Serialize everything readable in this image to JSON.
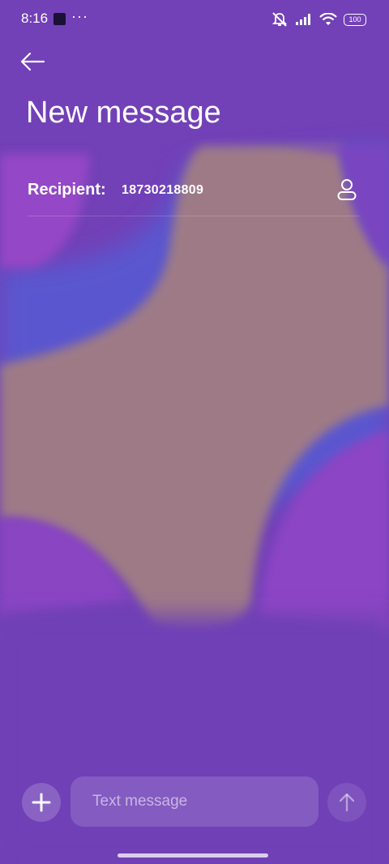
{
  "status_bar": {
    "time": "8:16",
    "dots": "···",
    "battery": "100",
    "icons": [
      "notification-square-icon",
      "mute-icon",
      "signal-icon",
      "wifi-icon",
      "battery-icon"
    ]
  },
  "header": {
    "back_icon": "back-arrow-icon",
    "title": "New message"
  },
  "recipient": {
    "label": "Recipient:",
    "value": "18730218809",
    "contact_icon": "contact-person-icon"
  },
  "compose": {
    "add_icon": "plus-icon",
    "placeholder": "Text message",
    "send_icon": "send-arrow-icon"
  },
  "colors": {
    "background": "#7340b8",
    "accent_blue": "#5a5ad0",
    "accent_tan": "#a07a7a",
    "accent_magenta": "#9848c8"
  }
}
